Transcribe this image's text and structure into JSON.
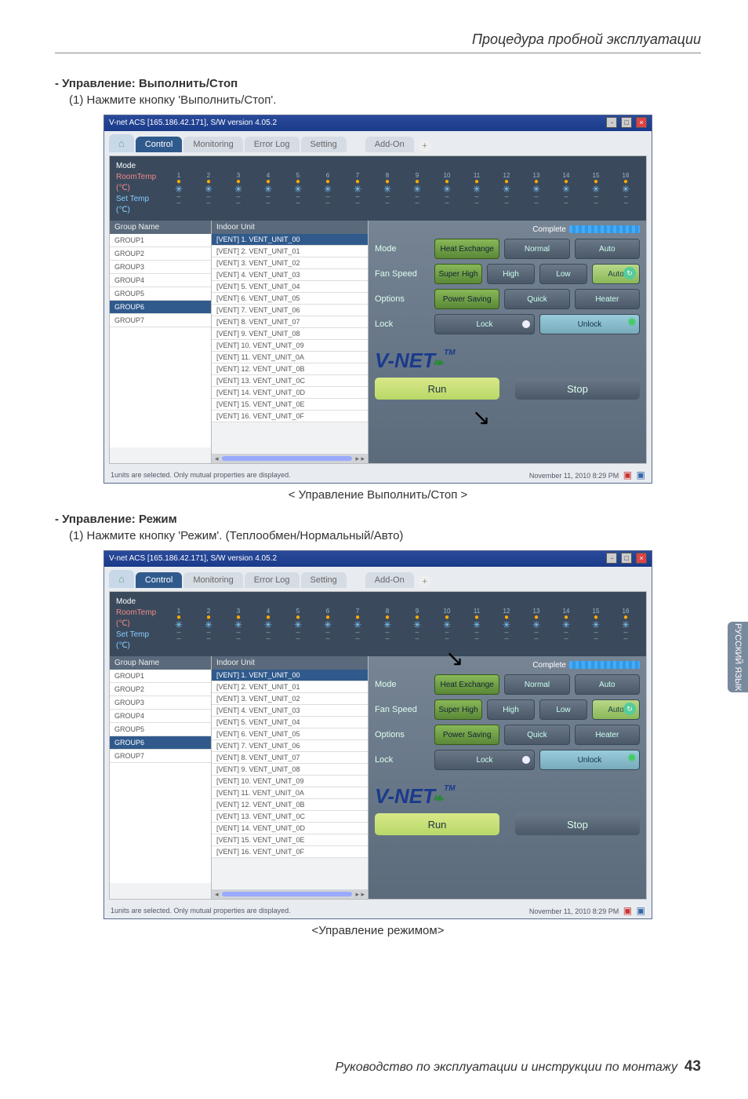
{
  "page": {
    "header": "Процедура пробной эксплуатации",
    "footer": "Руководство по эксплуатации и инструкции по монтажу",
    "pageNum": "43",
    "sideTab": "РУССКИЙ ЯЗЫК"
  },
  "sec1": {
    "head": "- Управление: Выполнить/Стоп",
    "sub": "(1) Нажмите кнопку 'Выполнить/Стоп'.",
    "caption": "< Управление Выполнить/Стоп >"
  },
  "sec2": {
    "head": "- Управление: Режим",
    "sub": "(1) Нажмите кнопку 'Режим'. (Теплообмен/Нормальный/Авто)",
    "caption": "<Управление режимом>"
  },
  "win": {
    "title": "V-net ACS [165.186.42.171],   S/W version 4.05.2",
    "tabs": {
      "home": "Home",
      "control": "Control",
      "monitoring": "Monitoring",
      "errorlog": "Error Log",
      "setting": "Setting",
      "addon": "Add-On",
      "plus": "+"
    },
    "stripLabels": {
      "mode": "Mode",
      "roomtemp": "RoomTemp (℃)",
      "settemp": "Set Temp  (℃)"
    },
    "stripCols": [
      "1",
      "2",
      "3",
      "4",
      "5",
      "6",
      "7",
      "8",
      "9",
      "10",
      "11",
      "12",
      "13",
      "14",
      "15",
      "16"
    ],
    "groupHdr": "Group Name",
    "groups": [
      "GROUP1",
      "GROUP2",
      "GROUP3",
      "GROUP4",
      "GROUP5",
      "GROUP6",
      "GROUP7"
    ],
    "selGroupIdx": 5,
    "unitHdr": "Indoor Unit",
    "units": [
      "[VENT] 1. VENT_UNIT_00",
      "[VENT] 2. VENT_UNIT_01",
      "[VENT] 3. VENT_UNIT_02",
      "[VENT] 4. VENT_UNIT_03",
      "[VENT] 5. VENT_UNIT_04",
      "[VENT] 6. VENT_UNIT_05",
      "[VENT] 7. VENT_UNIT_06",
      "[VENT] 8. VENT_UNIT_07",
      "[VENT] 9. VENT_UNIT_08",
      "[VENT] 10. VENT_UNIT_09",
      "[VENT] 11. VENT_UNIT_0A",
      "[VENT] 12. VENT_UNIT_0B",
      "[VENT] 13. VENT_UNIT_0C",
      "[VENT] 14. VENT_UNIT_0D",
      "[VENT] 15. VENT_UNIT_0E",
      "[VENT] 16. VENT_UNIT_0F"
    ],
    "selUnitIdx": 0,
    "complete": "Complete",
    "controls": {
      "mode": {
        "label": "Mode",
        "b1": "Heat Exchange",
        "b2": "Normal",
        "b3": "Auto"
      },
      "fan": {
        "label": "Fan Speed",
        "b1": "Super High",
        "b2": "High",
        "b3": "Low",
        "b4": "Auto"
      },
      "opt": {
        "label": "Options",
        "b1": "Power Saving",
        "b2": "Quick",
        "b3": "Heater"
      },
      "lock": {
        "label": "Lock",
        "b1": "Lock",
        "b2": "Unlock"
      }
    },
    "logo": {
      "text": "V-NET",
      "tm": "TM"
    },
    "run": "Run",
    "stop": "Stop",
    "status": "1units are selected. Only mutual properties are displayed.",
    "datetime": "November 11, 2010  8:29 PM"
  },
  "arrows": {
    "shot1": {
      "target": "run"
    },
    "shot2": {
      "target": "mode"
    }
  }
}
